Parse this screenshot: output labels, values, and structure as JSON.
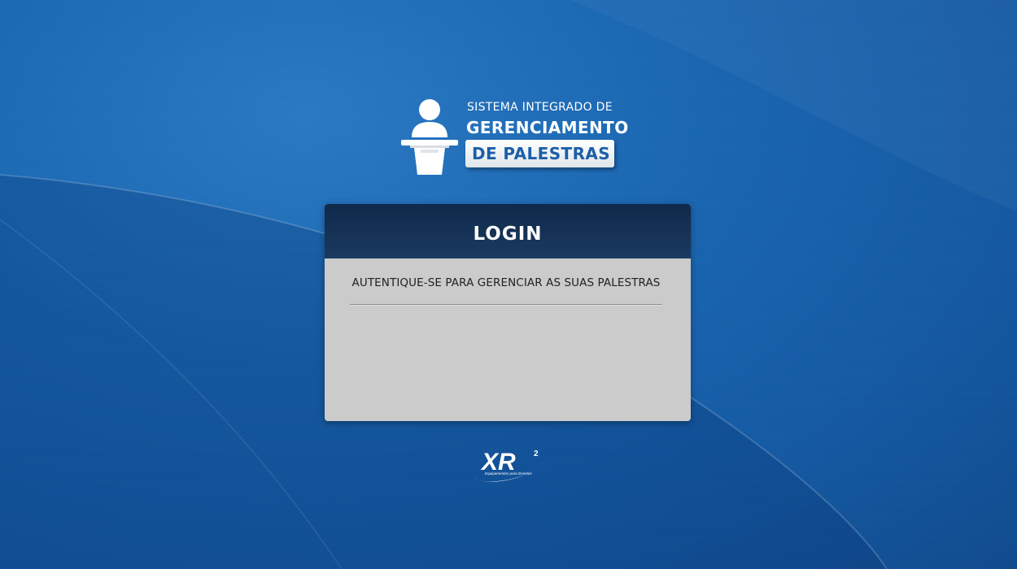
{
  "brand": {
    "line1": "SISTEMA INTEGRADO DE",
    "line2": "GERENCIAMENTO",
    "line3": "DE PALESTRAS",
    "icon": "speaker-podium-icon"
  },
  "login": {
    "title": "LOGIN",
    "subtitle": "AUTENTIQUE-SE PARA GERENCIAR AS SUAS PALESTRAS"
  },
  "footer": {
    "logo_text": "XR",
    "logo_sup": "2",
    "logo_tagline": "Equipamentos para Eventos"
  },
  "colors": {
    "background": "#1a67b2",
    "header": "#132f52",
    "panel": "#cbcbcb",
    "badge_text": "#1c5fa8"
  }
}
